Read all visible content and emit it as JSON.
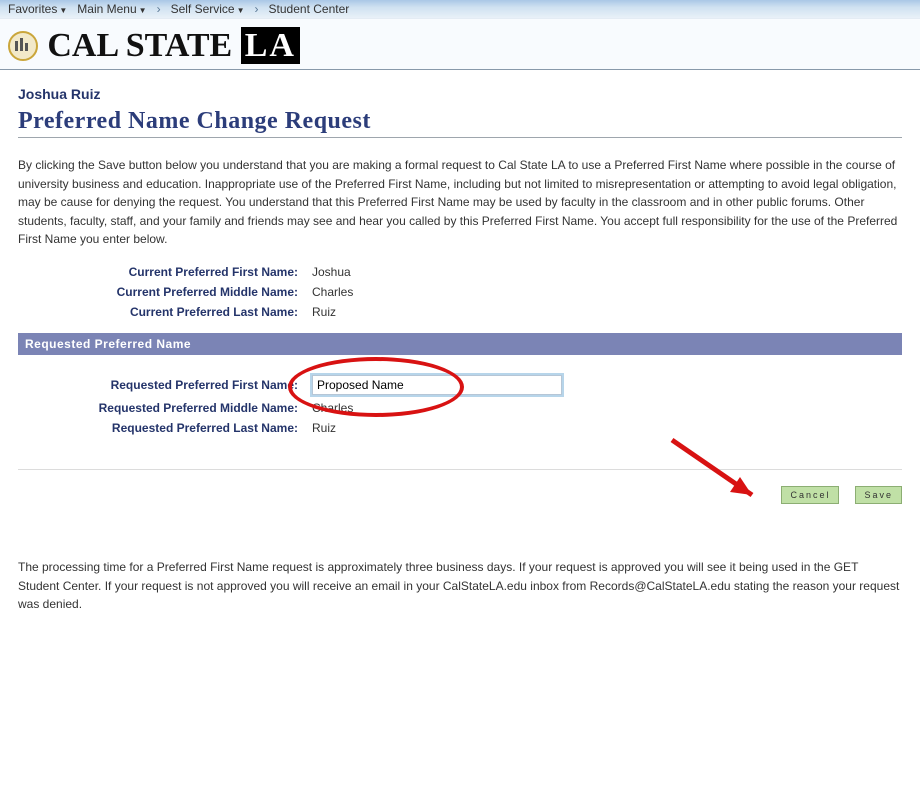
{
  "header": {
    "favorites": "Favorites",
    "main_menu": "Main Menu",
    "self_service": "Self Service",
    "student_center": "Student Center"
  },
  "brand": {
    "name": "CAL STATE",
    "suffix": "LA"
  },
  "student": {
    "name": "Joshua Ruiz"
  },
  "page": {
    "title": "Preferred Name Change Request"
  },
  "disclaimer": "By clicking the Save button below you understand that you are making a formal request to Cal State LA to use a Preferred First Name where possible in the course of university business and education. Inappropriate use of the Preferred First Name, including but not limited to misrepresentation or attempting to avoid legal obligation, may be cause for denying the request. You understand that this Preferred First Name may be used by faculty in the classroom and in other public forums. Other students, faculty, staff, and your family and friends may see and hear you called by this Preferred First Name. You accept full responsibility for the use of the Preferred First Name you enter below.",
  "current": {
    "first_label": "Current Preferred First Name:",
    "middle_label": "Current Preferred Middle Name:",
    "last_label": "Current Preferred Last Name:",
    "first": "Joshua",
    "middle": "Charles",
    "last": "Ruiz"
  },
  "section_title": "Requested Preferred Name",
  "requested": {
    "first_label": "Requested Preferred First Name:",
    "middle_label": "Requested Preferred Middle Name:",
    "last_label": "Requested Preferred Last Name:",
    "first_value": "Proposed Name",
    "middle": "Charles",
    "last": "Ruiz"
  },
  "buttons": {
    "cancel": "Cancel",
    "save": "Save"
  },
  "footer": "The processing time for a Preferred First Name request is approximately three business days. If your request is approved you will see it being used in the GET Student Center. If your request is not approved you will receive an email in your CalStateLA.edu inbox from Records@CalStateLA.edu stating the reason your request was denied."
}
